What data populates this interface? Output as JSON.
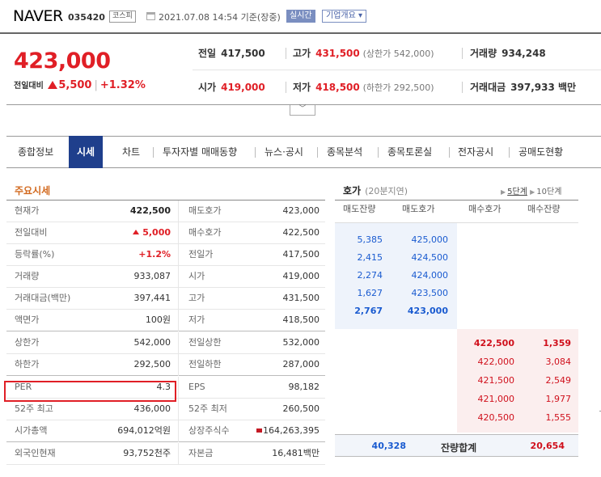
{
  "header": {
    "stock_name": "NAVER",
    "stock_code": "035420",
    "market": "코스피",
    "as_of": "2021.07.08 14:54  기준(장중)",
    "realtime_label": "실시간",
    "overview_label": "기업개요 ▾"
  },
  "summary": {
    "price": "423,000",
    "change_label": "전일대비",
    "change": "5,500",
    "change_pct": "+1.32%",
    "prev_close_label": "전일",
    "prev_close": "417,500",
    "high_label": "고가",
    "high": "431,500",
    "upper_limit": "(상한가 542,000)",
    "volume_label": "거래량",
    "volume": "934,248",
    "open_label": "시가",
    "open": "419,000",
    "low_label": "저가",
    "low": "418,500",
    "lower_limit": "(하한가 292,500)",
    "amount_label": "거래대금",
    "amount": "397,933 백만",
    "more_label": "﹀"
  },
  "tabs": [
    "종합정보",
    "시세",
    "차트",
    "투자자별 매매동향",
    "뉴스·공시",
    "종목분석",
    "종목토론실",
    "전자공시",
    "공매도현황"
  ],
  "active_tab": "시세",
  "quote": {
    "title": "주요시세",
    "rows": [
      {
        "k1": "현재가",
        "v1": "422,500",
        "k2": "매도호가",
        "v2": "423,000"
      },
      {
        "k1": "전일대비",
        "v1": "5,000",
        "k2": "매수호가",
        "v2": "422,500"
      },
      {
        "k1": "등락률(%)",
        "v1": "+1.2%",
        "k2": "전일가",
        "v2": "417,500"
      },
      {
        "k1": "거래량",
        "v1": "933,087",
        "k2": "시가",
        "v2": "419,000"
      },
      {
        "k1": "거래대금(백만)",
        "v1": "397,441",
        "k2": "고가",
        "v2": "431,500"
      },
      {
        "k1": "액면가",
        "v1": "100원",
        "k2": "저가",
        "v2": "418,500"
      },
      {
        "k1": "상한가",
        "v1": "542,000",
        "k2": "전일상한",
        "v2": "532,000"
      },
      {
        "k1": "하한가",
        "v1": "292,500",
        "k2": "전일하한",
        "v2": "287,000"
      },
      {
        "k1": "PER",
        "v1": "4.3",
        "k2": "EPS",
        "v2": "98,182"
      },
      {
        "k1": "52주 최고",
        "v1": "436,000",
        "k2": "52주 최저",
        "v2": "260,500"
      },
      {
        "k1": "시가총액",
        "v1": "694,012억원",
        "k2": "상장주식수",
        "v2": "164,263,395"
      },
      {
        "k1": "외국인현재",
        "v1": "93,752천주",
        "k2": "자본금",
        "v2": "16,481백만"
      }
    ]
  },
  "orderbook": {
    "title": "호가",
    "delay": "(20분지연)",
    "opt5": "5단계",
    "opt10": "10단계",
    "headers": [
      "매도잔량",
      "매도호가",
      "매수호가",
      "매수잔량"
    ],
    "asks": [
      {
        "qty": "5,385",
        "price": "425,000"
      },
      {
        "qty": "2,415",
        "price": "424,500"
      },
      {
        "qty": "2,274",
        "price": "424,000"
      },
      {
        "qty": "1,627",
        "price": "423,500"
      },
      {
        "qty": "2,767",
        "price": "423,000"
      }
    ],
    "bids": [
      {
        "price": "422,500",
        "qty": "1,359"
      },
      {
        "price": "422,000",
        "qty": "3,084"
      },
      {
        "price": "421,500",
        "qty": "2,549"
      },
      {
        "price": "421,000",
        "qty": "1,977"
      },
      {
        "price": "420,500",
        "qty": "1,555"
      }
    ],
    "total_ask": "40,328",
    "total_label": "잔량합계",
    "total_bid": "20,654"
  },
  "colors": {
    "up": "#e01f26",
    "ask": "#1a5bd0",
    "tab_active": "#1f3f8c",
    "section_title": "#d2691e"
  }
}
